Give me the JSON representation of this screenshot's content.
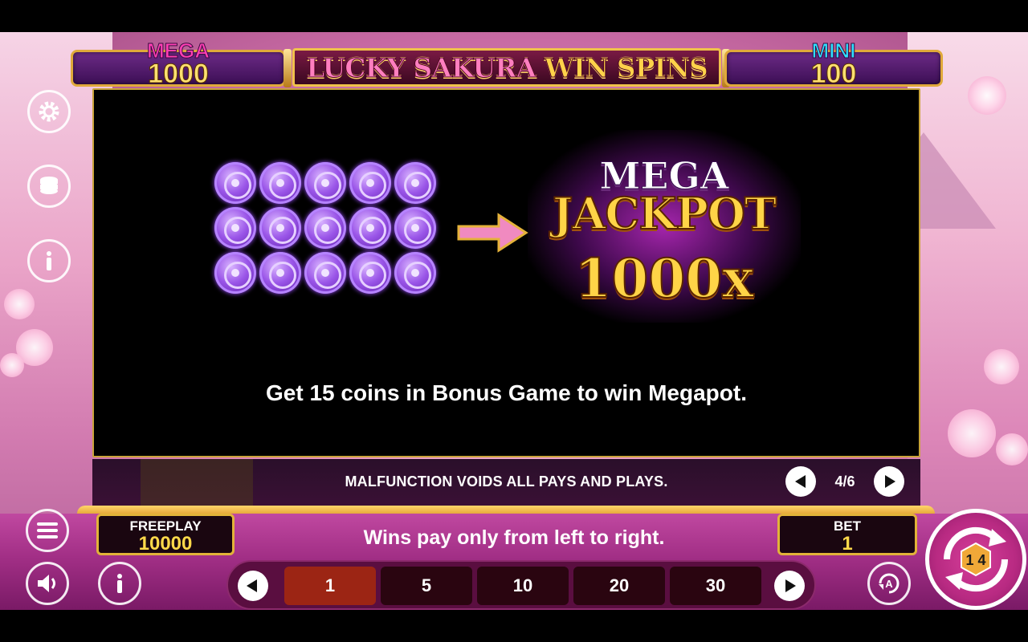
{
  "header": {
    "title_part1": "LUCKY SAKURA",
    "title_part2": "WIN SPINS",
    "mega": {
      "label": "MEGA",
      "value": "1000"
    },
    "mini": {
      "label": "MINI",
      "value": "100"
    }
  },
  "paytable": {
    "jackpot_line1": "MEGA",
    "jackpot_line2": "JACKPOT",
    "jackpot_line3": "1000x",
    "rule": "Get 15 coins in Bonus Game to win Megapot.",
    "coin_count": 15
  },
  "info_strip": {
    "malfunction": "MALFUNCTION VOIDS ALL PAYS AND PLAYS.",
    "page": "4/6"
  },
  "balance": {
    "label": "FREEPLAY",
    "value": "10000"
  },
  "bet": {
    "label": "BET",
    "value": "1"
  },
  "pay_note": "Wins pay only from left to right.",
  "bet_options": [
    "1",
    "5",
    "10",
    "20",
    "30"
  ],
  "selected_bet": "1",
  "spin_badge": "1 4",
  "colors": {
    "gold": "#e2b339",
    "mega_pink": "#ff3fb4",
    "mini_cyan": "#2de0ff",
    "selected_bet": "#9c2514"
  },
  "icons": [
    "settings-gear-icon",
    "coin-stack-icon",
    "info-icon",
    "menu-icon",
    "sound-icon",
    "info-icon",
    "autoplay-icon",
    "spin-icon"
  ]
}
